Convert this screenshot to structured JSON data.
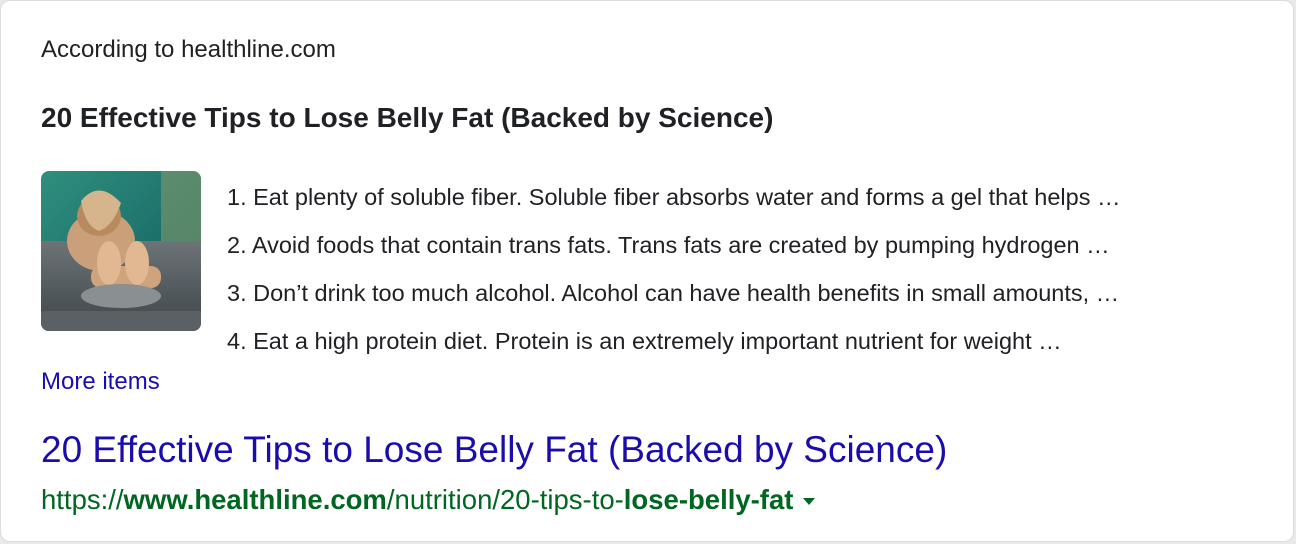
{
  "snippet": {
    "source_label": "According to healthline.com",
    "title": "20 Effective Tips to Lose Belly Fat (Backed by Science)",
    "thumbnail_icon": "yoga-stretch-photo",
    "items": [
      "1. Eat plenty of soluble fiber. Soluble fiber absorbs water and forms a gel that helps …",
      "2. Avoid foods that contain trans fats. Trans fats are created by pumping hydrogen …",
      "3. Don’t drink too much alcohol. Alcohol can have health benefits in small amounts, …",
      "4. Eat a high protein diet. Protein is an extremely important nutrient for weight …"
    ],
    "more_items_label": "More items"
  },
  "result": {
    "title": "20 Effective Tips to Lose Belly Fat (Backed by Science)",
    "url": {
      "scheme": "https://",
      "domain": "www.healthline.com",
      "path_plain": "/nutrition/20-tips-to-",
      "path_bold": "lose-belly-fat"
    },
    "dropdown_icon": "caret-down-icon"
  },
  "colors": {
    "link": "#1a0dab",
    "url_green": "#006621",
    "text": "#202124"
  }
}
